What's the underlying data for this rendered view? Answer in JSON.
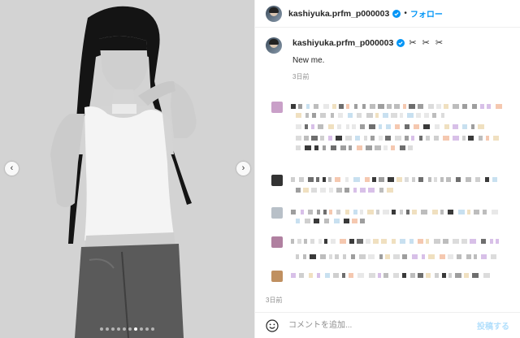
{
  "post": {
    "username": "kashiyuka.prfm_p000003",
    "follow_label": "フォロー",
    "separator": "•",
    "caption_emoji": "✂ ✂ ✂",
    "caption_text": "New me.",
    "caption_time": "3日前",
    "post_time": "3日前"
  },
  "media": {
    "prev_icon": "‹",
    "next_icon": "›",
    "slide_count": 10,
    "active_slide": 6
  },
  "composer": {
    "placeholder": "コメントを追加...",
    "post_label": "投稿する"
  },
  "colors": {
    "accent": "#0095f6",
    "post_disabled": "#b2dffc",
    "muted": "#8e8e8e"
  }
}
